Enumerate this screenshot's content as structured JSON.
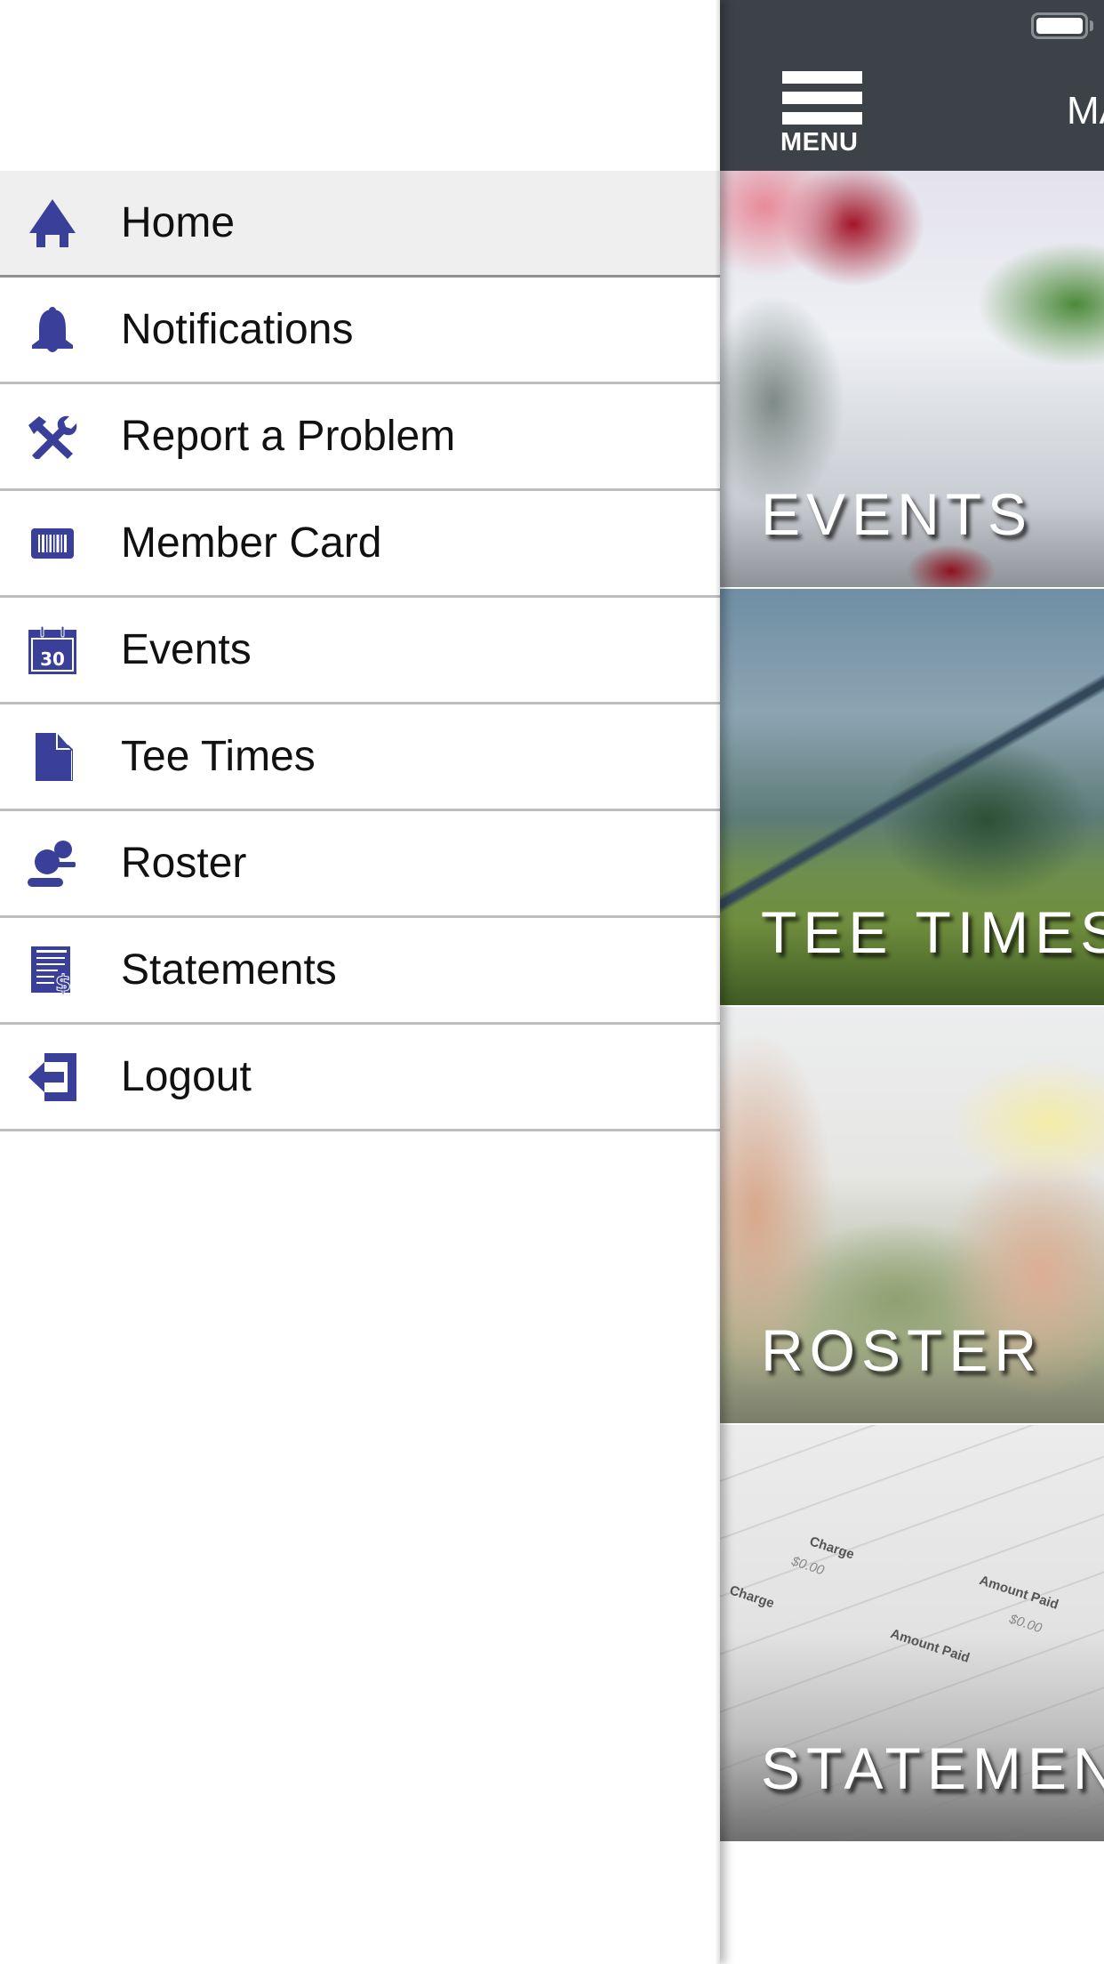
{
  "status_bar": {
    "battery_icon": "battery-full-icon"
  },
  "header": {
    "menu_icon": "hamburger-menu-icon",
    "menu_label": "MENU",
    "title_partial": "MA"
  },
  "drawer": {
    "accent_color": "#3a3f9a",
    "active_index": 0,
    "items": [
      {
        "label": "Home",
        "icon": "home-icon"
      },
      {
        "label": "Notifications",
        "icon": "bell-icon"
      },
      {
        "label": "Report a Problem",
        "icon": "tools-icon"
      },
      {
        "label": "Member Card",
        "icon": "barcode-card-icon"
      },
      {
        "label": "Events",
        "icon": "calendar-icon"
      },
      {
        "label": "Tee Times",
        "icon": "document-icon"
      },
      {
        "label": "Roster",
        "icon": "people-icon"
      },
      {
        "label": "Statements",
        "icon": "statement-dollar-icon"
      },
      {
        "label": "Logout",
        "icon": "logout-icon"
      }
    ],
    "calendar_day": "30"
  },
  "tiles": [
    {
      "label": "EVENTS"
    },
    {
      "label": "TEE TIMES"
    },
    {
      "label": "ROSTER"
    },
    {
      "label": "STATEMEN"
    }
  ],
  "statement_image_text": {
    "charge": "Charge",
    "amount_paid": "Amount Paid",
    "value": "$0.00"
  }
}
